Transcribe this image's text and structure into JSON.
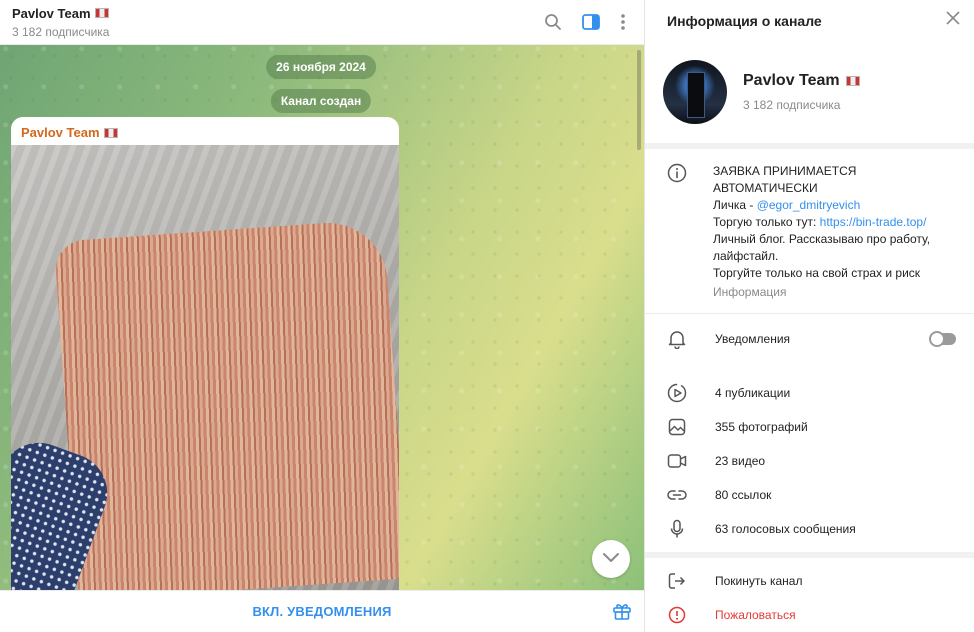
{
  "chat": {
    "title": "Pavlov Team",
    "subscribers": "3 182 подписчика",
    "date_pill": "26 ноября 2024",
    "created_pill": "Канал создан",
    "message_author": "Pavlov Team",
    "footer_button": "ВКЛ. УВЕДОМЛЕНИЯ"
  },
  "info": {
    "header_title": "Информация о канале",
    "name": "Pavlov Team",
    "subscribers": "3 182 подписчика",
    "about": {
      "line1": "ЗАЯВКА ПРИНИМАЕТСЯ",
      "line2": "АВТОМАТИЧЕСКИ",
      "line3_prefix": "Личка - ",
      "line3_link": "@egor_dmitryevich",
      "line4_prefix": "Торгую только тут: ",
      "line4_link": "https://bin-trade.top/",
      "line5": "Личный блог. Рассказываю про работу,",
      "line6": "лайфстайл.",
      "line7": "Торгуйте только на свой страх и риск",
      "label": "Информация"
    },
    "notifications_label": "Уведомления",
    "notifications_on": false,
    "stats": [
      {
        "label": "4 публикации",
        "icon": "stories-icon"
      },
      {
        "label": "355 фотографий",
        "icon": "photo-icon"
      },
      {
        "label": "23 видео",
        "icon": "video-icon"
      },
      {
        "label": "80 ссылок",
        "icon": "link-icon"
      },
      {
        "label": "63 голосовых сообщения",
        "icon": "microphone-icon"
      }
    ],
    "leave_label": "Покинуть канал",
    "report_label": "Пожаловаться"
  },
  "colors": {
    "accent": "#3390ec",
    "author": "#d2691e",
    "danger": "#e53935"
  }
}
